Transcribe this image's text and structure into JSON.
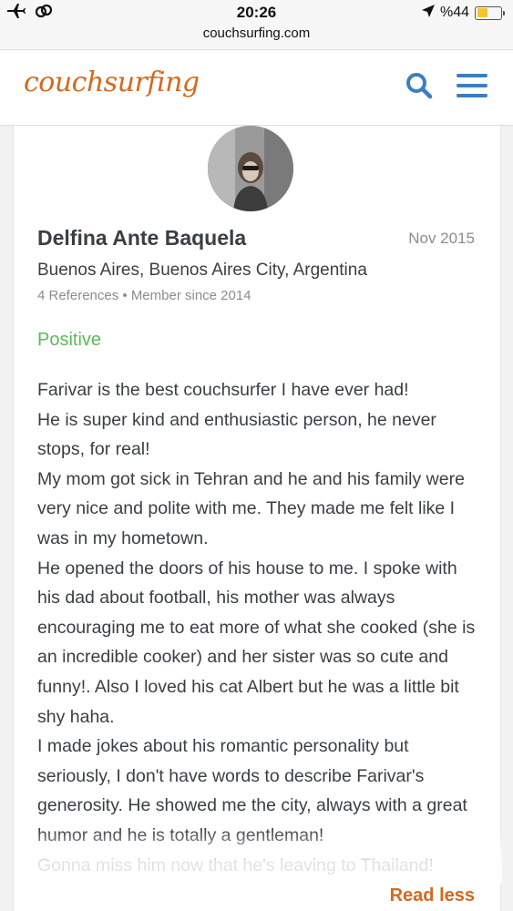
{
  "status_bar": {
    "time": "20:26",
    "url": "couchsurfing.com",
    "battery_text": "%44",
    "battery_level": 0.44,
    "icons": [
      "airplane-icon",
      "link-icon",
      "location-arrow-icon",
      "battery-icon"
    ]
  },
  "header": {
    "logo": "couchsurfing",
    "icons": [
      "search-icon",
      "menu-icon"
    ],
    "accent_color": "#3a7fc1"
  },
  "review": {
    "reviewer_name": "Delfina Ante Baquela",
    "date": "Nov 2015",
    "location": "Buenos Aires, Buenos Aires City, Argentina",
    "references": "4 References",
    "member_since": "Member since 2014",
    "rating": "Positive",
    "rating_color": "#5cb85c",
    "paragraphs": [
      "Farivar is the best couchsurfer I have ever had!",
      "He is super kind and enthusiastic person, he never stops, for real!",
      "My mom got sick in Tehran and he and his family were very nice and polite with me. They made me felt like I was in my hometown.",
      "He opened the doors of his house to me. I spoke with his dad about football, his mother was always encouraging me to eat more of what she cooked (she is an incredible cooker) and her sister was so cute and funny!. Also I loved his cat Albert but he was a little bit shy haha.",
      "I made jokes about his romantic personality but seriously, I don't have words to describe Farivar's generosity. He showed me the city, always with a great humor and he is totally a gentleman!",
      "Gonna miss him now that he's leaving to Thailand!"
    ],
    "read_less": "Read less",
    "link_color": "#d2691e"
  }
}
